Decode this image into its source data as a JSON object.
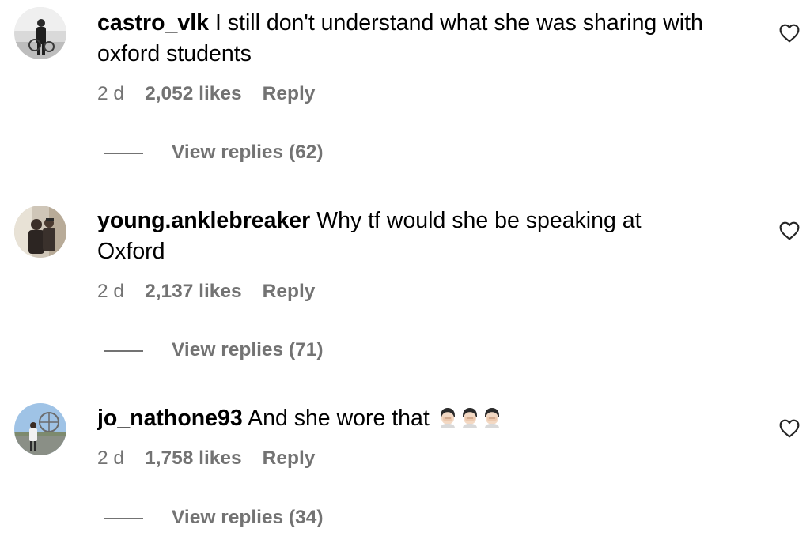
{
  "comments": [
    {
      "username": "castro_vlk",
      "text": "I still don't understand what she was sharing with oxford students",
      "time": "2 d",
      "likes": "2,052 likes",
      "reply_label": "Reply",
      "view_replies": "View replies (62)",
      "avatar_icon": "avatar-photo-grayscale",
      "like_icon": "heart-outline-icon"
    },
    {
      "username": "young.anklebreaker",
      "text": "Why tf would she be speaking at Oxford",
      "time": "2 d",
      "likes": "2,137 likes",
      "reply_label": "Reply",
      "view_replies": "View replies (71)",
      "avatar_icon": "avatar-photo-people",
      "like_icon": "heart-outline-icon"
    },
    {
      "username": "jo_nathone93",
      "text": "And she wore that",
      "emojis": [
        "facepalm-emoji",
        "facepalm-emoji",
        "facepalm-emoji"
      ],
      "time": "2 d",
      "likes": "1,758 likes",
      "reply_label": "Reply",
      "view_replies": "View replies (34)",
      "avatar_icon": "avatar-photo-outdoor",
      "like_icon": "heart-outline-icon"
    }
  ],
  "colors": {
    "text": "#000000",
    "secondary": "#737373",
    "background": "#ffffff"
  }
}
